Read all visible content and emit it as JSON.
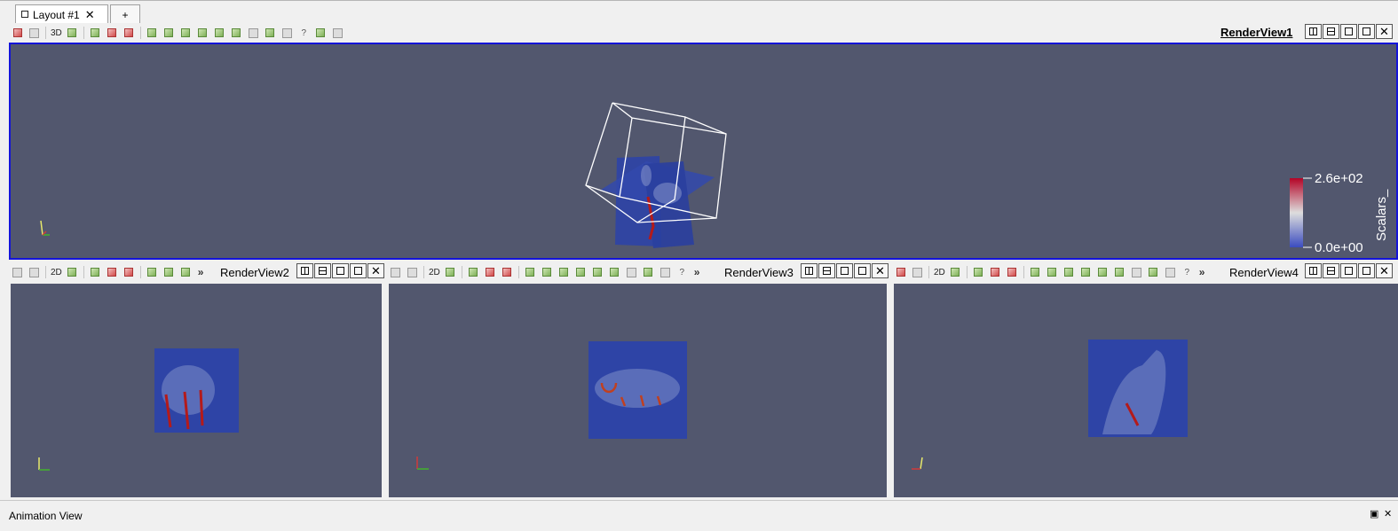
{
  "tabs": {
    "layout_label": "Layout #1",
    "close_glyph": "✕",
    "add_label": "+"
  },
  "views": {
    "view1": {
      "title": "RenderView1",
      "mode": "3D"
    },
    "view2": {
      "title": "RenderView2",
      "mode": "2D"
    },
    "view3": {
      "title": "RenderView3",
      "mode": "2D"
    },
    "view4": {
      "title": "RenderView4",
      "mode": "2D"
    }
  },
  "toolbar": {
    "more_glyph": "»",
    "help_glyph": "?"
  },
  "view_buttons": {
    "close_glyph": "✕"
  },
  "colorbar": {
    "title": "Scalars_",
    "max_label": "2.6e+02",
    "min_label": "0.0e+00",
    "colors": {
      "high": "#b40426",
      "mid": "#dddddd",
      "low": "#3b4cc0"
    }
  },
  "animation": {
    "title": "Animation View",
    "close_glyph": "✕"
  },
  "colors": {
    "background": "#52576e",
    "active_border": "#1414d9",
    "slice_blue": "#2e44a6"
  }
}
